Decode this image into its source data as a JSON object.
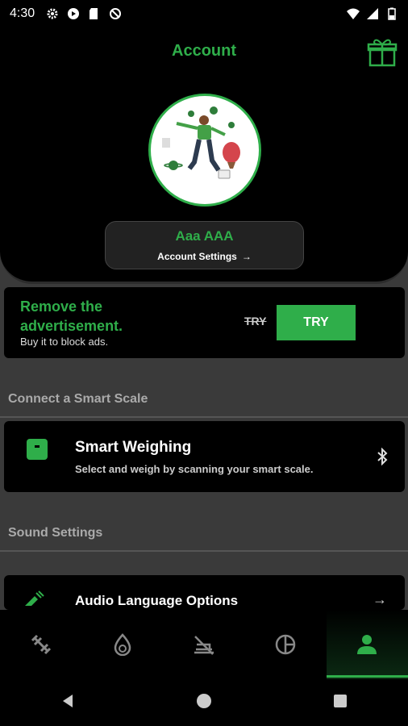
{
  "status": {
    "time": "4:30",
    "left_icons": [
      "gear-icon",
      "play-icon",
      "sd-card-icon",
      "no-signal-icon"
    ],
    "right_icons": [
      "wifi-icon",
      "cell-signal-icon",
      "battery-icon"
    ]
  },
  "header": {
    "title": "Account",
    "gift_icon": "gift-icon",
    "profile": {
      "name": "Aaa AAA",
      "settings_label": "Account Settings",
      "settings_arrow": "→"
    }
  },
  "ad": {
    "title": "Remove the advertisement.",
    "subtitle": "Buy it to block ads.",
    "old_label": "TRY",
    "button_label": "TRY"
  },
  "smart_scale": {
    "section_label": "Connect a Smart Scale",
    "item_title": "Smart Weighing",
    "item_desc": "Select and weigh by scanning your smart scale.",
    "icon": "bluetooth-icon"
  },
  "sound": {
    "section_label": "Sound Settings",
    "item_title": "Audio Language Options",
    "arrow": "→"
  },
  "tabs": [
    {
      "icon": "dumbbell-icon",
      "active": false
    },
    {
      "icon": "flame-icon",
      "active": false
    },
    {
      "icon": "no-food-icon",
      "active": false
    },
    {
      "icon": "pie-chart-icon",
      "active": false
    },
    {
      "icon": "person-icon",
      "active": true
    }
  ],
  "colors": {
    "accent": "#2fae4a",
    "background": "#000000",
    "panel": "#3a3a3a"
  }
}
